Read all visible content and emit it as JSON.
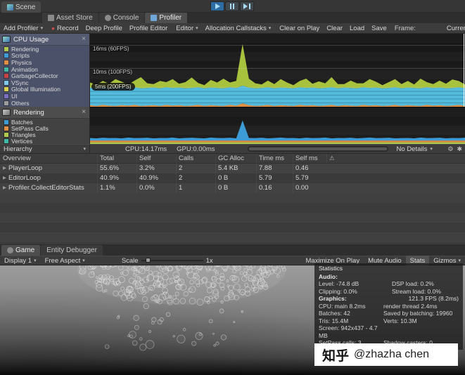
{
  "icons": {
    "close": "×",
    "dropdown": "▾",
    "record_dot": "●",
    "disclosure": "▶",
    "warning": "⚠",
    "gear": "⚙",
    "star": "✱",
    "frame_back": "◄"
  },
  "top": {
    "scene_tab": "Scene",
    "tabs": [
      {
        "label": "Asset Store"
      },
      {
        "label": "Console"
      },
      {
        "label": "Profiler"
      }
    ]
  },
  "profiler_toolbar": {
    "add_profiler": "Add Profiler",
    "record": "Record",
    "deep_profile": "Deep Profile",
    "profile_editor": "Profile Editor",
    "editor": "Editor",
    "allocation_callstacks": "Allocation Callstacks",
    "clear_on_play": "Clear on Play",
    "clear": "Clear",
    "load": "Load",
    "save": "Save",
    "frame_label": "Frame:",
    "frame_value": "Current"
  },
  "modules": {
    "cpu": {
      "title": "CPU Usage",
      "items": [
        {
          "label": "Rendering",
          "color": "#AEC94E"
        },
        {
          "label": "Scripts",
          "color": "#3D9CD6"
        },
        {
          "label": "Physics",
          "color": "#E08F44"
        },
        {
          "label": "Animation",
          "color": "#42B8A6"
        },
        {
          "label": "GarbageCollector",
          "color": "#C74444"
        },
        {
          "label": "VSync",
          "color": "#7EC9E8"
        },
        {
          "label": "Global Illumination",
          "color": "#D9D04F"
        },
        {
          "label": "UI",
          "color": "#7A6FC0"
        },
        {
          "label": "Others",
          "color": "#9C9C9C"
        }
      ]
    },
    "rendering": {
      "title": "Rendering",
      "items": [
        {
          "label": "Batches",
          "color": "#3D9CD6"
        },
        {
          "label": "SetPass Calls",
          "color": "#E08F44"
        },
        {
          "label": "Triangles",
          "color": "#AEC94E"
        },
        {
          "label": "Vertices",
          "color": "#42B8A6"
        }
      ]
    }
  },
  "stats_bar": {
    "hierarchy": "Hierarchy",
    "cpu": "CPU:14.17ms",
    "gpu": "GPU:0.00ms",
    "details": "No Details"
  },
  "table": {
    "columns": [
      "Overview",
      "Total",
      "Self",
      "Calls",
      "GC Alloc",
      "Time ms",
      "Self ms"
    ],
    "rows": [
      {
        "name": "PlayerLoop",
        "total": "55.6%",
        "self": "3.2%",
        "calls": "2",
        "gc": "5.4 KB",
        "time": "7.88",
        "selfms": "0.46"
      },
      {
        "name": "EditorLoop",
        "total": "40.9%",
        "self": "40.9%",
        "calls": "2",
        "gc": "0 B",
        "time": "5.79",
        "selfms": "5.79"
      },
      {
        "name": "Profiler.CollectEditorStats",
        "total": "1.1%",
        "self": "0.0%",
        "calls": "1",
        "gc": "0 B",
        "time": "0.16",
        "selfms": "0.00"
      }
    ]
  },
  "game": {
    "tabs": [
      {
        "label": "Game"
      },
      {
        "label": "Entity Debugger"
      }
    ],
    "toolbar": {
      "display": "Display 1",
      "aspect": "Free Aspect",
      "scale_label": "Scale",
      "scale_value": "1x",
      "maximize_on_play": "Maximize On Play",
      "mute_audio": "Mute Audio",
      "stats": "Stats",
      "gizmos": "Gizmos"
    },
    "stats_overlay": {
      "title": "Statistics",
      "audio_header": "Audio:",
      "audio_rows": [
        [
          "Level: -74.8 dB",
          "DSP load: 0.2%"
        ],
        [
          "Clipping: 0.0%",
          "Stream load: 0.0%"
        ]
      ],
      "graphics_header": "Graphics:",
      "fps": "121.3 FPS (8.2ms)",
      "graphics_rows": [
        [
          "CPU: main 8.2ms",
          "render thread 2.4ms"
        ],
        [
          "Batches: 42",
          "Saved by batching: 19960"
        ],
        [
          "Tris: 15.4M",
          "Verts: 10.3M"
        ],
        [
          "Screen: 942x437 - 4.7 MB",
          ""
        ],
        [
          "SetPass calls: 3",
          "Shadow casters: 0"
        ]
      ]
    }
  },
  "watermark": {
    "brand": "知乎",
    "handle": "@zhazha chen"
  },
  "chart_data": [
    {
      "type": "area",
      "title": "CPU Usage",
      "ylabel": "ms",
      "ylim": [
        0,
        19
      ],
      "legend_position": "left-sidebar",
      "gridlines": [
        {
          "value": 16,
          "label": "16ms (60FPS)"
        },
        {
          "value": 10,
          "label": "10ms (100FPS)"
        },
        {
          "value": 5,
          "label": "5ms (200FPS)"
        }
      ],
      "cursor": true,
      "bandlines": [
        1,
        2,
        3,
        4
      ],
      "series": [
        {
          "name": "GarbageCollector",
          "color": "#E08F44",
          "values": [
            0.4,
            0.2,
            0.5,
            0.3,
            0.2,
            0.4,
            0.3,
            0.5,
            0.2,
            0.3,
            0.4,
            0.2,
            0.5,
            0.3,
            0.4,
            0.2,
            0.3,
            0.5,
            0.2,
            0.4,
            0.3,
            0.2,
            0.5,
            0.3,
            0.9,
            0.4,
            0.2,
            0.3,
            0.5,
            0.2,
            0.4,
            0.3,
            0.2,
            0.5,
            0.3,
            0.4,
            0.2,
            0.3,
            0.5,
            0.2,
            0.4,
            0.3,
            0.2,
            0.5,
            0.3,
            0.4,
            0.2,
            0.3,
            0.5,
            0.2,
            0.4,
            0.3,
            0.2,
            0.5,
            0.3,
            0.4,
            0.2,
            0.3,
            0.5,
            0.2
          ]
        },
        {
          "name": "VSync",
          "color": "#54BBDD",
          "constant": 4.6
        },
        {
          "name": "Rendering",
          "color": "#A8C23E",
          "values": [
            1.3,
            0.9,
            1.6,
            1.1,
            2.4,
            1.5,
            0.8,
            1.7,
            2.9,
            1.2,
            0.9,
            1.9,
            1.3,
            2.3,
            1.0,
            1.6,
            2.7,
            1.1,
            0.8,
            2.0,
            1.4,
            2.5,
            1.2,
            1.8,
            10.8,
            2.3,
            1.3,
            0.9,
            1.7,
            1.1,
            2.2,
            1.4,
            0.8,
            1.6,
            2.4,
            1.0,
            1.8,
            1.2,
            2.6,
            1.1,
            0.9,
            1.9,
            1.3,
            1.0,
            2.3,
            1.5,
            0.8,
            1.5,
            2.1,
            1.1,
            1.7,
            0.9,
            2.5,
            1.3,
            1.0,
            1.8,
            1.2,
            2.2,
            1.6,
            1.0
          ]
        }
      ]
    },
    {
      "type": "area",
      "title": "Rendering",
      "ylim": [
        0,
        20
      ],
      "series": [
        {
          "name": "Triangles",
          "color": "#AEC94E",
          "constant": 0.9
        },
        {
          "name": "SetPass Calls",
          "color": "#E08F44",
          "constant": 1.0
        },
        {
          "name": "Batches",
          "color": "#3D9CD6",
          "values": [
            1.4,
            1.2,
            1.5,
            1.3,
            1.4,
            1.2,
            1.6,
            1.3,
            1.4,
            1.5,
            1.2,
            1.4,
            1.3,
            1.6,
            1.2,
            1.4,
            1.5,
            1.3,
            1.2,
            1.6,
            1.4,
            1.3,
            1.5,
            1.2,
            11.0,
            1.4,
            1.3,
            1.5,
            1.2,
            1.4,
            1.6,
            1.3,
            1.4,
            1.2,
            1.5,
            1.3,
            1.4,
            1.6,
            1.2,
            1.4,
            1.3,
            1.5,
            1.2,
            1.4,
            1.6,
            1.3,
            1.4,
            1.5,
            1.2,
            1.3,
            1.4,
            1.2,
            1.6,
            1.3,
            1.4,
            1.5,
            1.2,
            1.4,
            1.3,
            1.5
          ]
        }
      ]
    }
  ]
}
